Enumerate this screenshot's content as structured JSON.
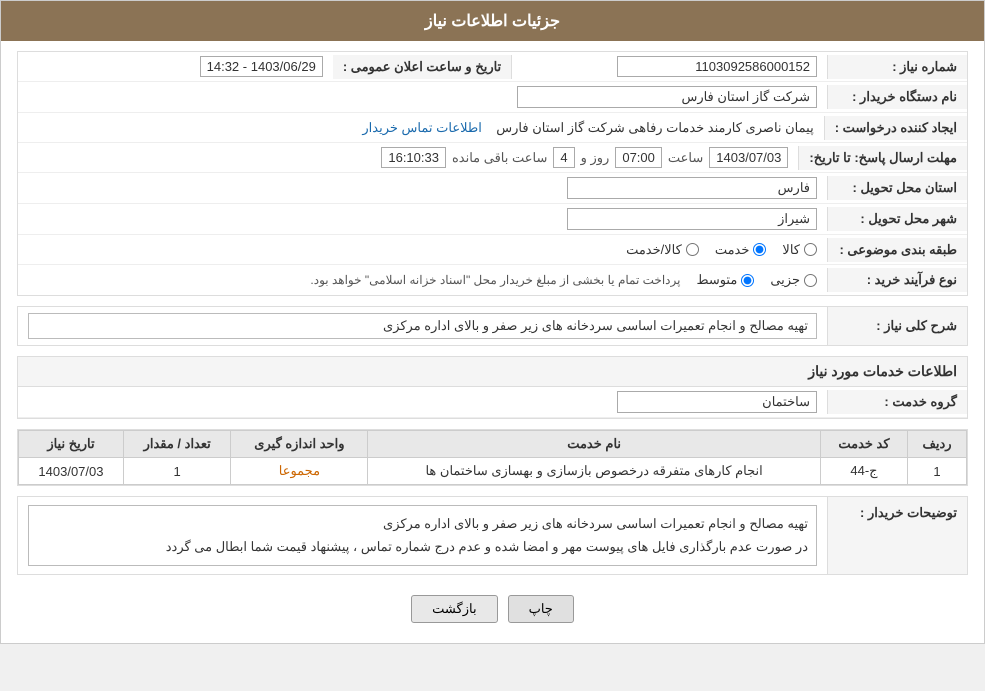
{
  "header": {
    "title": "جزئیات اطلاعات نیاز"
  },
  "fields": {
    "shomareNiaz_label": "شماره نیاز :",
    "shomareNiaz_value": "1103092586000152",
    "namDastgah_label": "نام دستگاه خریدار :",
    "namDastgah_value": "شرکت گاز استان فارس",
    "ijadKonande_label": "ایجاد کننده درخواست :",
    "ijadKonande_value": "پیمان ناصری کارمند خدمات رفاهی شرکت گاز استان فارس",
    "mohlat_label": "مهلت ارسال پاسخ: تا تاریخ:",
    "mohlat_date": "1403/07/03",
    "mohlat_saat_label": "ساعت",
    "mohlat_saat_value": "07:00",
    "mohlat_roz_label": "روز و",
    "mohlat_roz_value": "4",
    "mohlat_bagi_label": "ساعت باقی مانده",
    "mohlat_bagi_value": "16:10:33",
    "ostan_label": "استان محل تحویل :",
    "ostan_value": "فارس",
    "shahr_label": "شهر محل تحویل :",
    "shahr_value": "شیراز",
    "tabaghe_label": "طبقه بندی موضوعی :",
    "tabaghe_radio1": "کالا",
    "tabaghe_radio2": "خدمت",
    "tabaghe_radio3": "کالا/خدمت",
    "noFarayand_label": "نوع فرآیند خرید :",
    "noFarayand_radio1": "جزیی",
    "noFarayand_radio2": "متوسط",
    "noFarayand_note": "پرداخت تمام یا بخشی از مبلغ خریدار محل \"اسناد خزانه اسلامی\" خواهد بود.",
    "tArikhoSaat_label": "تاریخ و ساعت اعلان عمومی :",
    "tArikhoSaat_value": "1403/06/29 - 14:32",
    "ettelaat_link": "اطلاعات تماس خریدار",
    "sharhKolli_label": "شرح کلی نیاز :",
    "sharhKolli_value": "تهیه مصالح و انجام تعمیرات اساسی سردخانه های زیر صفر و بالای اداره مرکزی",
    "ettelaatKhadamat_title": "اطلاعات خدمات مورد نیاز",
    "groheKhadamat_label": "گروه خدمت :",
    "groheKhadamat_value": "ساختمان",
    "table": {
      "headers": [
        "ردیف",
        "کد خدمت",
        "نام خدمت",
        "واحد اندازه گیری",
        "تعداد / مقدار",
        "تاریخ نیاز"
      ],
      "rows": [
        {
          "radif": "1",
          "kodKhadamat": "ج-44",
          "namKhadamat": "انجام کارهای متفرقه درخصوص بازسازی و بهسازی ساختمان ها",
          "vahed": "مجموعا",
          "tedad": "1",
          "tarikh": "1403/07/03"
        }
      ]
    },
    "towsiyat_label": "توضیحات خریدار :",
    "towsiyat_line1": "تهیه مصالح و انجام تعمیرات اساسی سردخانه های زیر صفر و بالای اداره مرکزی",
    "towsiyat_line2": "در صورت عدم بارگذاری فایل های پیوست مهر و امضا شده و عدم درج شماره تماس ، پیشنهاد قیمت شما ابطال می گردد"
  },
  "buttons": {
    "chap_label": "چاپ",
    "bazgasht_label": "بازگشت"
  }
}
